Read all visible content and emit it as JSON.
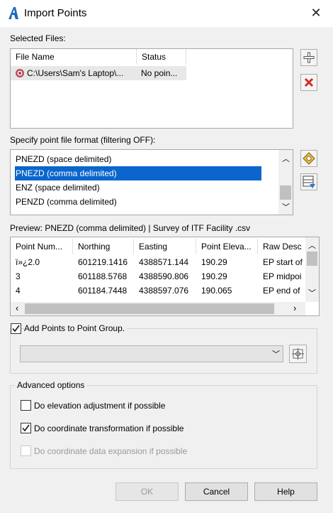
{
  "window": {
    "title": "Import Points",
    "close_icon": "close-icon",
    "app_icon": "autocad-logo-icon"
  },
  "selected_files": {
    "label": "Selected Files:",
    "columns": [
      "File Name",
      "Status"
    ],
    "rows": [
      {
        "file": "C:\\Users\\Sam's Laptop\\...",
        "status": "No poin..."
      }
    ],
    "add_button_icon": "plus-icon",
    "remove_button_icon": "red-x-icon"
  },
  "format": {
    "label": "Specify point file format (filtering OFF):",
    "items": [
      "PNEZD (space delimited)",
      "PNEZD (comma delimited)",
      "ENZ (space delimited)",
      "PENZD (comma delimited)"
    ],
    "selected_index": 1
  },
  "preview": {
    "label": "Preview: PNEZD (comma delimited) | Survey of ITF Facility .csv",
    "columns": [
      "Point Num...",
      "Northing",
      "Easting",
      "Point Eleva...",
      "Raw Desc"
    ],
    "rows": [
      [
        "ï»¿2.0",
        "601219.1416",
        "4388571.144",
        "190.29",
        "EP start of"
      ],
      [
        "3",
        "601188.5768",
        "4388590.806",
        "190.29",
        "EP midpoi"
      ],
      [
        "4",
        "601184.7448",
        "4388597.076",
        "190.065",
        "EP end of"
      ]
    ]
  },
  "point_group": {
    "checkbox_label": "Add Points to Point Group.",
    "checked": true,
    "dropdown_value": ""
  },
  "advanced": {
    "title": "Advanced options",
    "options": [
      {
        "label": "Do elevation adjustment if possible",
        "checked": false,
        "enabled": true
      },
      {
        "label": "Do coordinate transformation if possible",
        "checked": true,
        "enabled": true
      },
      {
        "label": "Do coordinate data expansion if possible",
        "checked": false,
        "enabled": false
      }
    ]
  },
  "buttons": {
    "ok": "OK",
    "cancel": "Cancel",
    "help": "Help"
  }
}
